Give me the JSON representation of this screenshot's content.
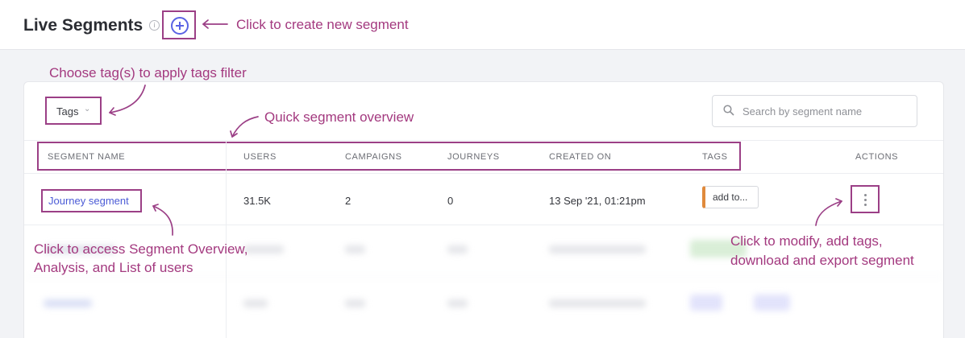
{
  "header": {
    "title": "Live Segments",
    "info_glyph": "i"
  },
  "annotations": {
    "create": "Click to create new segment",
    "tags": "Choose tag(s) to apply tags filter",
    "overview": "Quick segment overview",
    "segment_line1": "Click to access Segment Overview,",
    "segment_line2": "Analysis, and List of users",
    "actions_line1": "Click to modify, add tags,",
    "actions_line2": "download and export segment"
  },
  "filter": {
    "tags_label": "Tags",
    "chevron": "⌄"
  },
  "search": {
    "placeholder": "Search by segment name"
  },
  "table": {
    "columns": [
      "SEGMENT NAME",
      "USERS",
      "CAMPAIGNS",
      "JOURNEYS",
      "CREATED ON",
      "TAGS",
      "ACTIONS"
    ],
    "rows": [
      {
        "name": "Journey segment",
        "users": "31.5K",
        "campaigns": "2",
        "journeys": "0",
        "created_on": "13 Sep '21, 01:21pm",
        "tag_button": "add to..."
      }
    ]
  },
  "colors": {
    "annotation": "#a3397f",
    "link": "#4b5bd6",
    "accent": "#5a63e4",
    "tag_chip": "#e08a3c"
  },
  "icons": [
    "info-icon",
    "plus-circle-icon",
    "chevron-down-icon",
    "search-icon",
    "kebab-menu-icon"
  ]
}
